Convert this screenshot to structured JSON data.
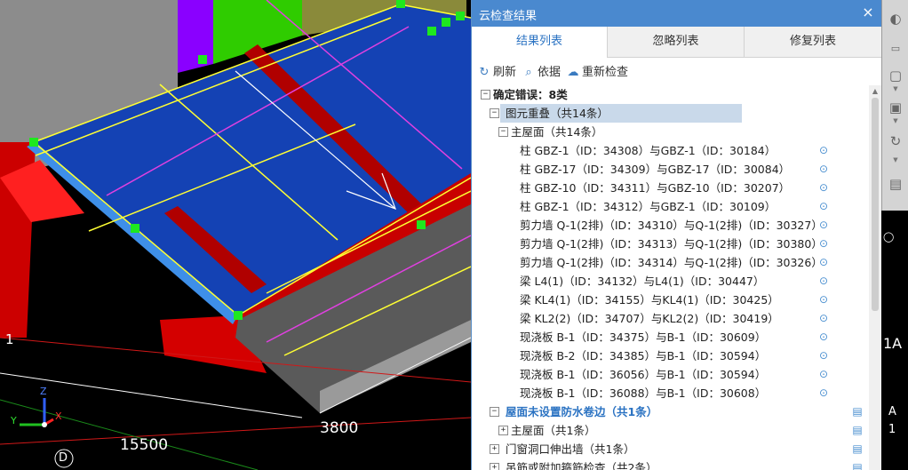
{
  "viewport": {
    "labels": {
      "dim_left": "15500",
      "dim_right": "3800",
      "axis_one": "1",
      "grid_d": "D",
      "axis_z": "Z",
      "axis_y": "Y",
      "axis_x": "X"
    },
    "right_labels": {
      "a": "A",
      "one_a": "1A",
      "a_bottom": "A",
      "one_bottom": "1"
    }
  },
  "panel": {
    "title": "云检查结果",
    "close": "×",
    "tabs": [
      {
        "label": "结果列表"
      },
      {
        "label": "忽略列表"
      },
      {
        "label": "修复列表"
      }
    ],
    "actions": {
      "refresh": "刷新",
      "basis": "依据",
      "recheck": "重新检查"
    },
    "tree": [
      {
        "level": 0,
        "toggle": "−",
        "text": "确定错误：8类",
        "style": "bold"
      },
      {
        "level": 1,
        "toggle": "−",
        "text": "图元重叠（共14条）",
        "style": "hl"
      },
      {
        "level": 2,
        "toggle": "−",
        "text": "主屋面（共14条）"
      },
      {
        "level": 3,
        "text": "柱 GBZ-1（ID：34308）与GBZ-1（ID：30184）",
        "icon": "loc"
      },
      {
        "level": 3,
        "text": "柱 GBZ-17（ID：34309）与GBZ-17（ID：30084）",
        "icon": "loc"
      },
      {
        "level": 3,
        "text": "柱 GBZ-10（ID：34311）与GBZ-10（ID：30207）",
        "icon": "loc"
      },
      {
        "level": 3,
        "text": "柱 GBZ-1（ID：34312）与GBZ-1（ID：30109）",
        "icon": "loc"
      },
      {
        "level": 3,
        "text": "剪力墙 Q-1(2排)（ID：34310）与Q-1(2排)（ID：30327）",
        "icon": "loc"
      },
      {
        "level": 3,
        "text": "剪力墙 Q-1(2排)（ID：34313）与Q-1(2排)（ID：30380）",
        "icon": "loc"
      },
      {
        "level": 3,
        "text": "剪力墙 Q-1(2排)（ID：34314）与Q-1(2排)（ID：30326）",
        "icon": "loc"
      },
      {
        "level": 3,
        "text": "梁 L4(1)（ID：34132）与L4(1)（ID：30447）",
        "icon": "loc"
      },
      {
        "level": 3,
        "text": "梁 KL4(1)（ID：34155）与KL4(1)（ID：30425）",
        "icon": "loc"
      },
      {
        "level": 3,
        "text": "梁 KL2(2)（ID：34707）与KL2(2)（ID：30419）",
        "icon": "loc"
      },
      {
        "level": 3,
        "text": "现浇板 B-1（ID：34375）与B-1（ID：30609）",
        "icon": "loc"
      },
      {
        "level": 3,
        "text": "现浇板 B-2（ID：34385）与B-1（ID：30594）",
        "icon": "loc"
      },
      {
        "level": 3,
        "text": "现浇板 B-1（ID：36056）与B-1（ID：30594）",
        "icon": "loc"
      },
      {
        "level": 3,
        "text": "现浇板 B-1（ID：36088）与B-1（ID：30608）",
        "icon": "loc"
      },
      {
        "level": 1,
        "toggle": "−",
        "text": "屋面未设置防水卷边（共1条）",
        "style": "blue",
        "icon": "doc"
      },
      {
        "level": 2,
        "toggle": "+",
        "text": "主屋面（共1条）",
        "icon": "doc"
      },
      {
        "level": 1,
        "toggle": "+",
        "text": "门窗洞口伸出墙（共1条）",
        "icon": "doc"
      },
      {
        "level": 1,
        "toggle": "+",
        "text": "吊筋或附加箍筋检查（共2条）",
        "icon": "doc"
      }
    ]
  },
  "colors": {
    "titlebar": "#4a89cf",
    "active_tab_text": "#2a72c2",
    "selection": "#c9d9ea",
    "slab_blue": "#1442b4",
    "beam_red": "#c80000",
    "edge_yellow": "#ffff33",
    "line_magenta": "#e040e0",
    "grip_green": "#00ee00"
  }
}
